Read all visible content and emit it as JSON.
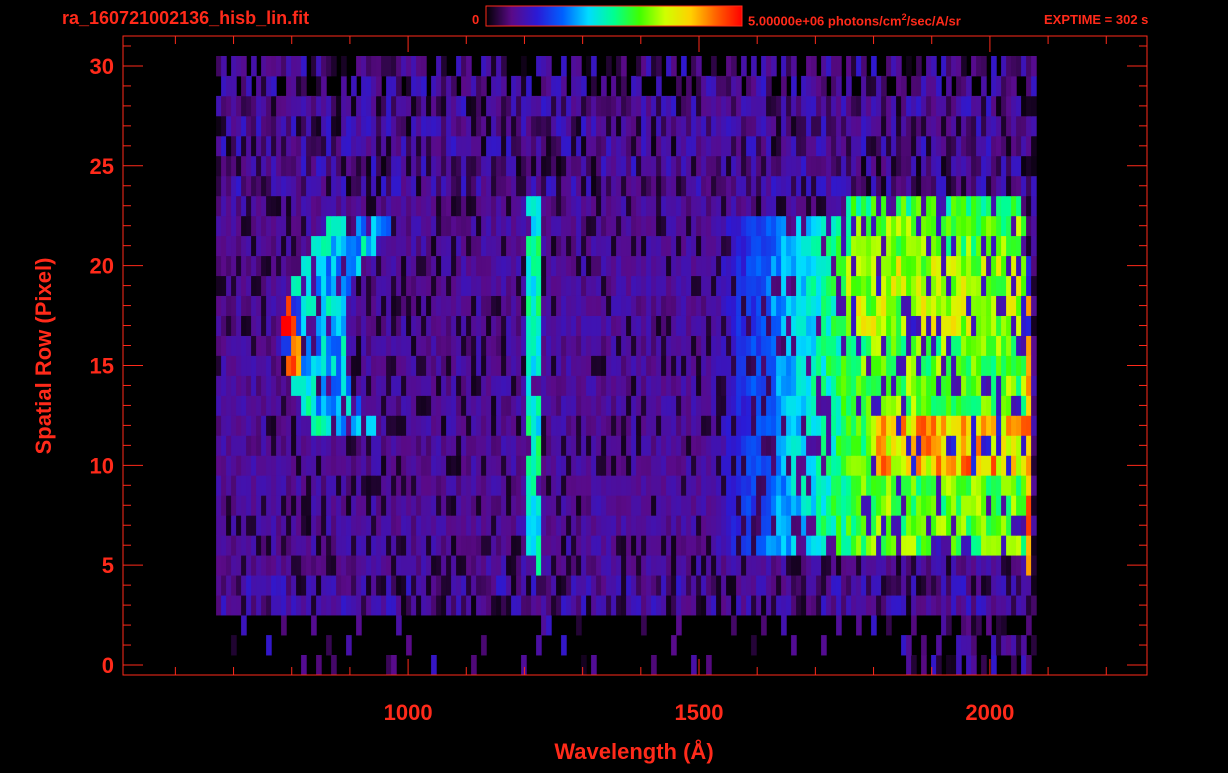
{
  "header": {
    "filename": "ra_160721002136_hisb_lin.fit",
    "colorbar_min": "0",
    "colorbar_max_value": "5.00000e+06",
    "colorbar_units_prefix": " photons/cm",
    "colorbar_units_sup": "2",
    "colorbar_units_suffix": "/sec/A/sr",
    "exptime": "EXPTIME = 302 s"
  },
  "colors": {
    "axis": "#ff2a1a",
    "background": "#000000",
    "colormap": [
      "#000000",
      "#5a0a88",
      "#2a1ad6",
      "#0060ff",
      "#00dcff",
      "#00ff90",
      "#40ff00",
      "#d0ff00",
      "#ffd000",
      "#ff6000",
      "#ff0000"
    ]
  },
  "chart_data": {
    "type": "heatmap",
    "title": "ra_160721002136_hisb_lin.fit",
    "xlabel": "Wavelength (Å)",
    "ylabel": "Spatial Row (Pixel)",
    "xlim": [
      510,
      2270
    ],
    "ylim": [
      -0.5,
      31.5
    ],
    "xticks": [
      1000,
      1500,
      2000
    ],
    "xticks_labels": [
      "1000",
      "1500",
      "2000"
    ],
    "yticks": [
      0,
      5,
      10,
      15,
      20,
      25,
      30
    ],
    "yticks_labels": [
      "0",
      "5",
      "10",
      "15",
      "20",
      "25",
      "30"
    ],
    "x_minor_step": 100,
    "y_minor_step": 1,
    "grid": false,
    "colorbar": {
      "min": 0,
      "max": 5000000,
      "units": "photons/cm^2/sec/A/sr",
      "placement": "top"
    },
    "data_range": {
      "x": [
        670,
        2075
      ],
      "rows": [
        0,
        30
      ]
    },
    "features": [
      {
        "name": "emission arc",
        "wavelength": [
          790,
          830
        ],
        "rows": [
          13,
          20
        ],
        "peak_wavelength": 800,
        "peak_rows": [
          15,
          18
        ],
        "peak_level": 0.97
      },
      {
        "name": "emission arc outer",
        "wavelength": [
          830,
          920
        ],
        "rows": [
          12,
          22
        ],
        "level": 0.45
      },
      {
        "name": "Lyman alpha line",
        "wavelength": [
          1195,
          1225
        ],
        "rows": [
          5,
          23
        ],
        "level": 0.5
      },
      {
        "name": "continuum",
        "wavelength": [
          1600,
          2060
        ],
        "rows": [
          6,
          22
        ],
        "level": 0.62,
        "peak_wavelength": 1950,
        "peak_rows": [
          10,
          12
        ],
        "peak_level": 0.82
      },
      {
        "name": "red edge",
        "wavelength": [
          2055,
          2065
        ],
        "rows": [
          5,
          20
        ],
        "level": 0.9
      }
    ]
  }
}
